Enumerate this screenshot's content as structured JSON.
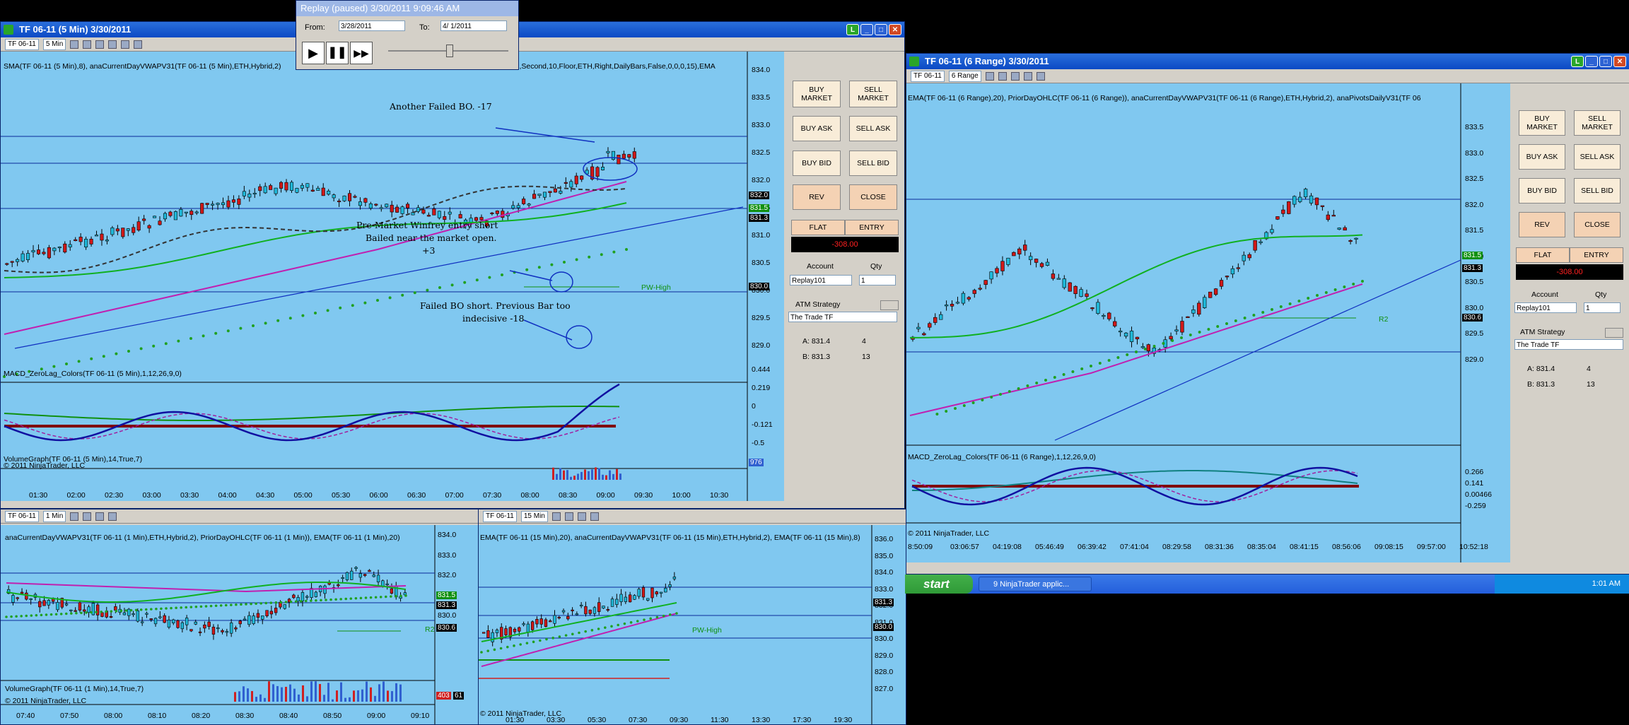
{
  "replay": {
    "title": "Replay (paused) 3/30/2011 9:09:46 AM",
    "from_label": "From:",
    "from_value": "3/28/2011",
    "to_label": "To:",
    "to_value": "4/ 1/2011"
  },
  "win1": {
    "title": "TF 06-11 (5 Min)  3/30/2011",
    "instrument": "TF 06-11",
    "interval": "5 Min",
    "indicators": "SMA(TF 06-11 (5 Min),8), anaCurrentDayVWAPV31(TF 06-11 (5 Min),ETH,Hybrid,2)",
    "indicators_tail": "),Second,10,Floor,ETH,Right,DailyBars,False,0,0,0,15),EMA",
    "macd_label": "MACD_ZeroLag_Colors(TF 06-11 (5 Min),1,12,26,9,0)",
    "volume_label": "VolumeGraph(TF 06-11 (5 Min),14,True,7)",
    "copyright": "© 2011 NinjaTrader, LLC",
    "notes": {
      "failed_bo": "Another Failed BO. -17",
      "premarket1": "Pre-Market Winfrey entry short",
      "premarket2": "Bailed near the market open.",
      "premarket3": "+3",
      "failed_short1": "Failed BO short. Previous Bar too",
      "failed_short2": "indecisive -18",
      "pw_high": "PW-High"
    },
    "price_ticks": [
      "834.0",
      "833.5",
      "833.0",
      "832.5",
      "832.0",
      "831.5",
      "831.0",
      "830.5",
      "830.0",
      "829.5",
      "829.0"
    ],
    "price_boxes": [
      "832.0",
      "831.5",
      "831.3",
      "830.0"
    ],
    "macd_ticks": [
      "0.444",
      "0.219",
      "0",
      "-0.121",
      "-0.5"
    ],
    "vol_tick": "976",
    "time_ticks": [
      "01:30",
      "02:00",
      "02:30",
      "03:00",
      "03:30",
      "04:00",
      "04:30",
      "05:00",
      "05:30",
      "06:00",
      "06:30",
      "07:00",
      "07:30",
      "08:00",
      "08:30",
      "09:00",
      "09:30",
      "10:00",
      "10:30"
    ]
  },
  "panel1": {
    "buy_market": "BUY MARKET",
    "sell_market": "SELL MARKET",
    "buy_ask": "BUY ASK",
    "sell_ask": "SELL ASK",
    "buy_bid": "BUY BID",
    "sell_bid": "SELL BID",
    "rev": "REV",
    "close": "CLOSE",
    "flat": "FLAT",
    "entry": "ENTRY",
    "pnl": "-308.00",
    "account_label": "Account",
    "qty_label": "Qty",
    "account": "Replay101",
    "qty": "1",
    "atm_label": "ATM Strategy",
    "atm": "The Trade TF",
    "ask_label": "A: 831.4",
    "ask_size": "4",
    "bid_label": "B: 831.3",
    "bid_size": "13"
  },
  "win2": {
    "title": "TF 06-11 (6 Range)  3/30/2011",
    "instrument": "TF 06-11",
    "interval": "6 Range",
    "indicators": "EMA(TF 06-11 (6 Range),20), PriorDayOHLC(TF 06-11 (6 Range)), anaCurrentDayVWAPV31(TF 06-11 (6 Range),ETH,Hybrid,2), anaPivotsDailyV31(TF 06",
    "macd_label": "MACD_ZeroLag_Colors(TF 06-11 (6 Range),1,12,26,9,0)",
    "copyright": "© 2011 NinjaTrader, LLC",
    "r2": "R2",
    "price_ticks": [
      "833.5",
      "833.0",
      "832.5",
      "832.0",
      "831.5",
      "831.0",
      "830.5",
      "830.0",
      "829.5",
      "829.0"
    ],
    "price_boxes": [
      "831.5",
      "831.3",
      "830.6"
    ],
    "macd_ticks": [
      "0.266",
      "0.141",
      "0.00466",
      "-0.259"
    ],
    "time_ticks": [
      "8:50:09",
      "03:06:57",
      "04:19:08",
      "05:46:49",
      "06:39:42",
      "07:41:04",
      "08:29:58",
      "08:31:36",
      "08:35:04",
      "08:41:15",
      "08:56:06",
      "09:08:15",
      "09:57:00",
      "10:52:18"
    ]
  },
  "panel2": {
    "buy_market": "BUY MARKET",
    "sell_market": "SELL MARKET",
    "buy_ask": "BUY ASK",
    "sell_ask": "SELL ASK",
    "buy_bid": "BUY BID",
    "sell_bid": "SELL BID",
    "rev": "REV",
    "close": "CLOSE",
    "flat": "FLAT",
    "entry": "ENTRY",
    "pnl": "-308.00",
    "account_label": "Account",
    "qty_label": "Qty",
    "account": "Replay101",
    "qty": "1",
    "atm_label": "ATM Strategy",
    "atm": "The Trade TF",
    "ask_label": "A: 831.4",
    "ask_size": "4",
    "bid_label": "B: 831.3",
    "bid_size": "13"
  },
  "win3": {
    "instrument": "TF 06-11",
    "interval": "1 Min",
    "indicators": "anaCurrentDayVWAPV31(TF 06-11 (1 Min),ETH,Hybrid,2), PriorDayOHLC(TF 06-11 (1 Min)), EMA(TF 06-11 (1 Min),20)",
    "volume_label": "VolumeGraph(TF 06-11 (1 Min),14,True,7)",
    "copyright": "© 2011 NinjaTrader, LLC",
    "r2": "R2",
    "price_ticks": [
      "834.0",
      "833.0",
      "832.0",
      "831.0",
      "830.0"
    ],
    "price_boxes": [
      "831.5",
      "831.3",
      "830.6"
    ],
    "vol_ticks": [
      "403",
      "61"
    ],
    "time_ticks": [
      "07:40",
      "07:50",
      "08:00",
      "08:10",
      "08:20",
      "08:30",
      "08:40",
      "08:50",
      "09:00",
      "09:10"
    ]
  },
  "win4": {
    "instrument": "TF 06-11",
    "interval": "15 Min",
    "indicators": "EMA(TF 06-11 (15 Min),20), anaCurrentDayVWAPV31(TF 06-11 (15 Min),ETH,Hybrid,2), EMA(TF 06-11 (15 Min),8)",
    "copyright": "© 2011 NinjaTrader, LLC",
    "pw_high": "PW-High",
    "price_ticks": [
      "836.0",
      "835.0",
      "834.0",
      "833.0",
      "832.0",
      "831.0",
      "830.0",
      "829.0",
      "828.0",
      "827.0"
    ],
    "price_boxes": [
      "831.3",
      "830.0"
    ],
    "time_ticks": [
      "01:30",
      "03:30",
      "05:30",
      "07:30",
      "09:30",
      "11:30",
      "13:30",
      "17:30",
      "19:30"
    ]
  },
  "taskbar": {
    "start": "start",
    "task": "9 NinjaTrader applic...",
    "clock": "1:01 AM"
  },
  "colors": {
    "chart_bg": "#80c8f0",
    "up_candle": "#1fb8d8",
    "down_candle": "#d01818",
    "ema_green": "#10b020",
    "vwap_magenta": "#c020b0",
    "macd_blue": "#1010a0"
  }
}
